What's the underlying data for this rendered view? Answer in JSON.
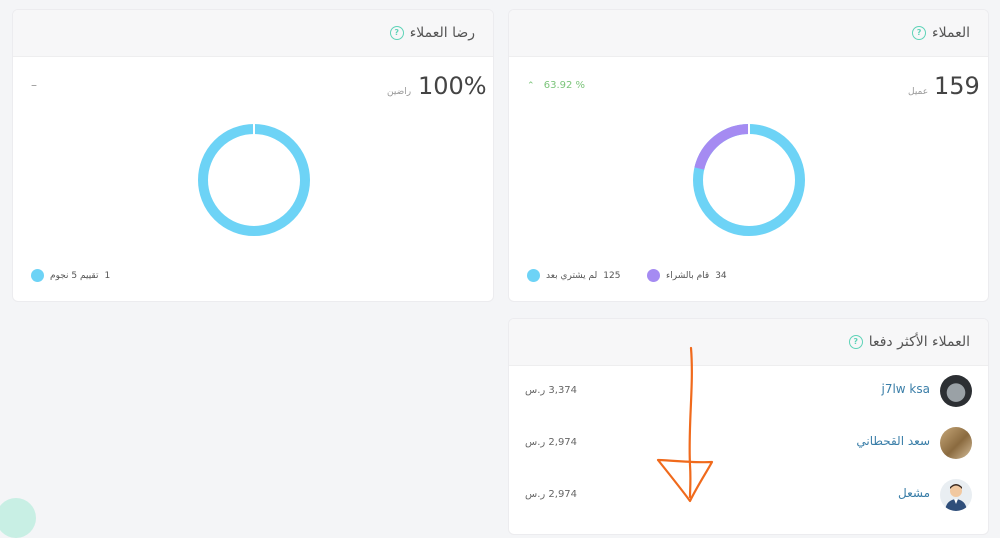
{
  "customers": {
    "title": "العملاء",
    "count": "159",
    "count_label": "عميل",
    "trend": "63.92 %",
    "donut": {
      "purchased": 34,
      "not_purchased": 125
    },
    "legend": [
      {
        "value": "34",
        "label": "قام بالشراء",
        "color": "#a58bf2"
      },
      {
        "value": "125",
        "label": "لم يشتري بعد",
        "color": "#6dd3f6"
      }
    ]
  },
  "satisfaction": {
    "title": "رضا العملاء",
    "percent": "100%",
    "percent_label": "راضين",
    "dash": "–",
    "legend": [
      {
        "value": "1",
        "label": "تقييم 5 نجوم",
        "color": "#6dd3f6"
      }
    ]
  },
  "top_paying": {
    "title": "العملاء الأكثر دفعا",
    "rows": [
      {
        "name": "j7lw ksa",
        "amount": "3,374 ر.س"
      },
      {
        "name": "سعد القحطاني",
        "amount": "2,974 ر.س"
      },
      {
        "name": "مشعل",
        "amount": "2,974 ر.س"
      }
    ]
  },
  "colors": {
    "primary": "#6dd3f6",
    "secondary": "#a58bf2",
    "accent": "#5fd3b8",
    "annotation": "#f06a1c"
  }
}
